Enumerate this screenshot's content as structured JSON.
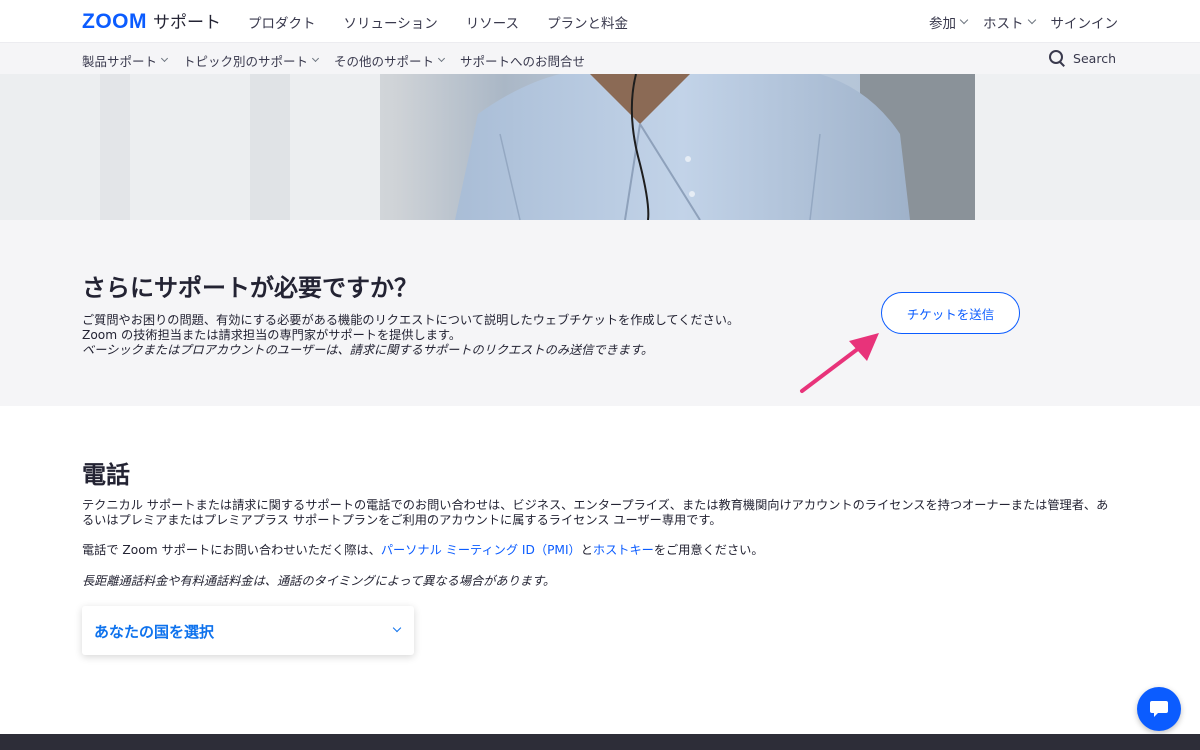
{
  "header": {
    "logo_brand": "ZOOM",
    "logo_section": "サポート",
    "nav": [
      "プロダクト",
      "ソリューション",
      "リソース",
      "プランと料金"
    ],
    "right": {
      "join": "参加",
      "host": "ホスト",
      "signin": "サインイン"
    }
  },
  "subnav": {
    "items": [
      "製品サポート",
      "トピック別のサポート",
      "その他のサポート",
      "サポートへのお問合せ"
    ],
    "search": "Search"
  },
  "ticket": {
    "title": "さらにサポートが必要ですか？",
    "description": "ご質問やお困りの問題、有効にする必要がある機能のリクエストについて説明したウェブチケットを作成してください。Zoom の技術担当または請求担当の専門家がサポートを提供します。",
    "note": "ベーシックまたはプロアカウントのユーザーは、請求に関するサポートのリクエストのみ送信できます。",
    "button": "チケットを送信"
  },
  "phone": {
    "title": "電話",
    "description": "テクニカル サポートまたは請求に関するサポートの電話でのお問い合わせは、ビジネス、エンタープライズ、または教育機関向けアカウントのライセンスを持つオーナーまたは管理者、あるいはプレミアまたはプレミアプラス サポートプランをご利用のアカウントに属するライセンス ユーザー専用です。",
    "prepare_prefix": "電話で Zoom サポートにお問い合わせいただく際は、",
    "pmi_link": "パーソナル ミーティング ID（PMI）",
    "conjunction": "と",
    "host_key_link": "ホストキー",
    "prepare_suffix": "をご用意ください。",
    "note": "長距離通話料金や有料通話料金は、通話のタイミングによって異なる場合があります。",
    "country_select": "あなたの国を選択"
  },
  "colors": {
    "accent": "#0b5cff",
    "link": "#0e72ed",
    "annotation_arrow": "#e8337a",
    "footer": "#2d2d38",
    "section_bg": "#f5f5f7"
  },
  "icons": {
    "search": "search-icon",
    "chat": "chat-icon",
    "dropdown": "chevron-down-icon",
    "annotation": "arrow-annotation-icon"
  }
}
